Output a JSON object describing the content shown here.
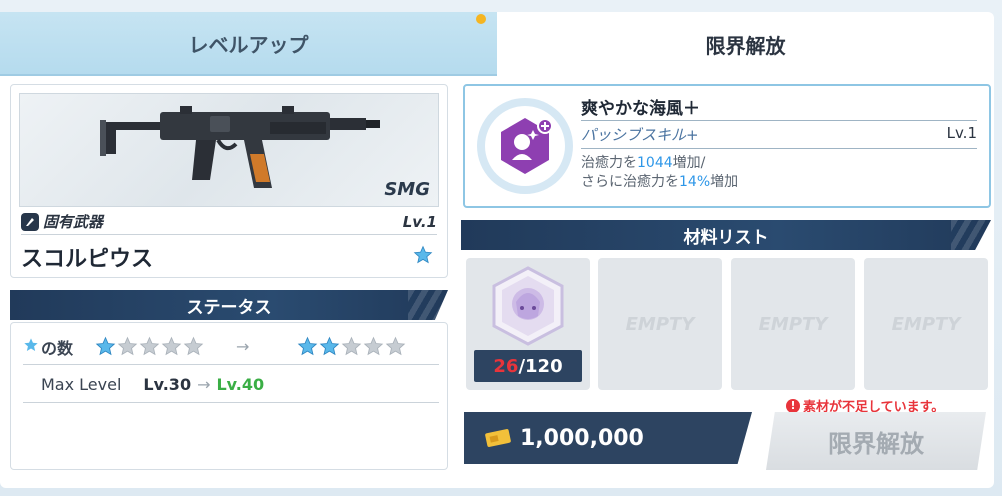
{
  "tabs": {
    "levelup": "レベルアップ",
    "limit_break": "限界解放"
  },
  "weapon": {
    "type": "SMG",
    "category": "固有武器",
    "level": "Lv.1",
    "name": "スコルピウス",
    "star_icon": "star-icon"
  },
  "status": {
    "header": "ステータス",
    "star_count_label": "の数",
    "stars_before": 1,
    "stars_after": 2,
    "stars_total": 5,
    "arrow": "→",
    "max_level_label": "Max Level",
    "max_level_from": "Lv.30",
    "max_level_to": "Lv.40"
  },
  "skill": {
    "name": "爽やかな海風＋",
    "type": "パッシブスキル+",
    "level": "Lv.1",
    "desc_prefix1": "治癒力を",
    "desc_value1": "1044",
    "desc_suffix1": "増加/",
    "desc_prefix2": "さらに治癒力を",
    "desc_value2": "14%",
    "desc_suffix2": "増加"
  },
  "materials": {
    "header": "材料リスト",
    "have": "26",
    "need": "/120",
    "empty_label": "EMPTY"
  },
  "cost": {
    "amount": "1,000,000"
  },
  "warning": "素材が不足しています。",
  "button": "限界解放",
  "colors": {
    "accent_blue": "#2e97e8",
    "navy": "#2d4461",
    "warning_red": "#e8343b",
    "level_green": "#3aae45",
    "star_blue": "#59b8ea"
  }
}
